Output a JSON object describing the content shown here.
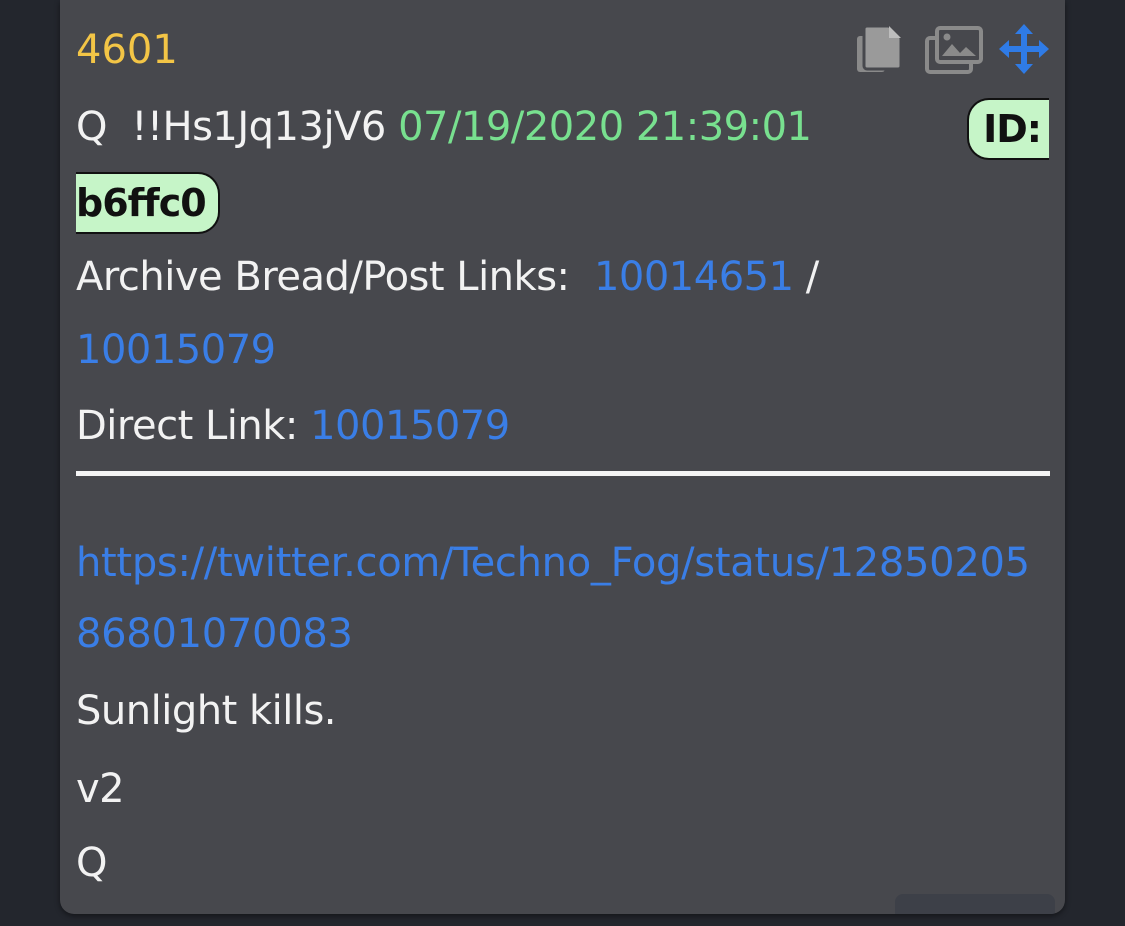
{
  "post": {
    "number": "4601",
    "author": "Q",
    "tripcode": "!!Hs1Jq13jV6",
    "datetime": "07/19/2020 21:39:01",
    "id_label": "ID:",
    "id_value": "b6ffc0",
    "archive_label": "Archive Bread/Post Links:",
    "archive_link_1": "10014651",
    "archive_separator": "/",
    "archive_link_2": "10015079",
    "direct_label": "Direct Link:",
    "direct_link": "10015079",
    "url": "https://twitter.com/Techno_Fog/status/1285020586801070083",
    "body_lines": [
      "Sunlight kills.",
      "v2",
      "Q"
    ]
  },
  "toolbar": {
    "icons": [
      "copy-icon",
      "images-icon",
      "move-icon"
    ]
  },
  "colors": {
    "background": "#23262d",
    "card": "#47484d",
    "post_number": "#f3c546",
    "date": "#78e08f",
    "link": "#3a7ee6",
    "id_pill": "#c6f5c8"
  }
}
